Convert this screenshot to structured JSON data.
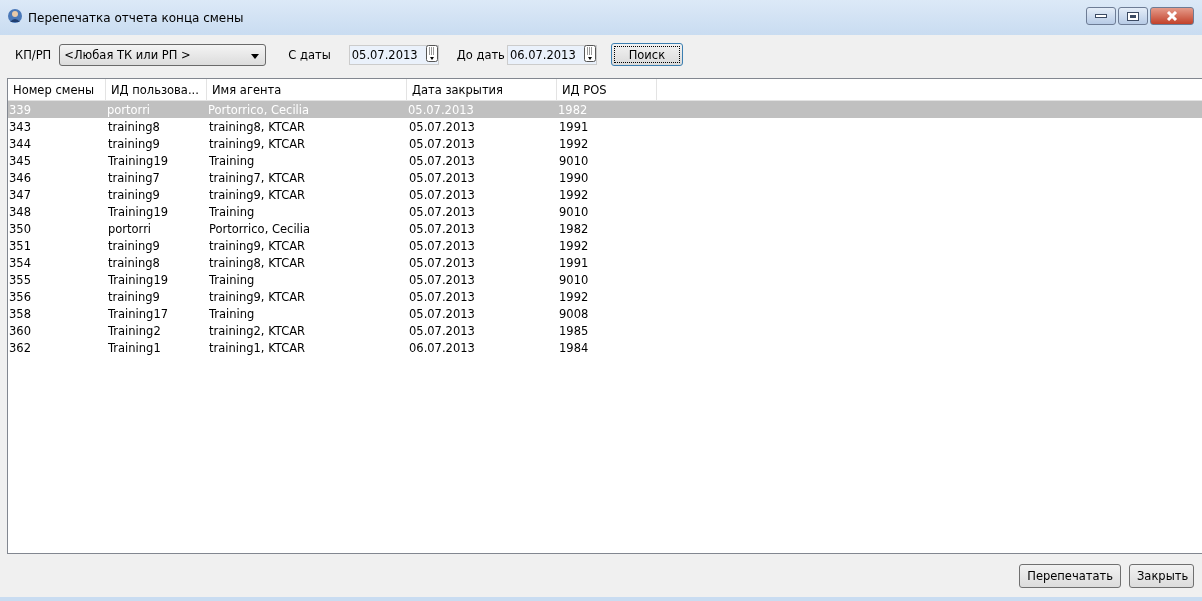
{
  "window": {
    "title": "Перепечатка отчета конца смены"
  },
  "filters": {
    "station_label": "КП/РП",
    "station_value": "<Любая ТК или РП >",
    "from_label": "С даты",
    "from_value": "05.07.2013",
    "to_label": "До дать",
    "to_value": "06.07.2013",
    "search_button": "Поиск"
  },
  "table": {
    "columns": [
      "Номер смены",
      "ИД пользова...",
      "Имя агента",
      "Дата закрытия",
      "ИД POS"
    ],
    "rows": [
      {
        "cells": [
          "339",
          "portorri",
          "Portorrico, Cecilia",
          "05.07.2013",
          "1982"
        ],
        "selected": true
      },
      {
        "cells": [
          "343",
          "training8",
          "training8, KTCAR",
          "05.07.2013",
          "1991"
        ],
        "selected": false
      },
      {
        "cells": [
          "344",
          "training9",
          "training9, KTCAR",
          "05.07.2013",
          "1992"
        ],
        "selected": false
      },
      {
        "cells": [
          "345",
          "Training19",
          "Training",
          "05.07.2013",
          "9010"
        ],
        "selected": false
      },
      {
        "cells": [
          "346",
          "training7",
          "training7, KTCAR",
          "05.07.2013",
          "1990"
        ],
        "selected": false
      },
      {
        "cells": [
          "347",
          "training9",
          "training9, KTCAR",
          "05.07.2013",
          "1992"
        ],
        "selected": false
      },
      {
        "cells": [
          "348",
          "Training19",
          "Training",
          "05.07.2013",
          "9010"
        ],
        "selected": false
      },
      {
        "cells": [
          "350",
          "portorri",
          "Portorrico, Cecilia",
          "05.07.2013",
          "1982"
        ],
        "selected": false
      },
      {
        "cells": [
          "351",
          "training9",
          "training9, KTCAR",
          "05.07.2013",
          "1992"
        ],
        "selected": false
      },
      {
        "cells": [
          "354",
          "training8",
          "training8, KTCAR",
          "05.07.2013",
          "1991"
        ],
        "selected": false
      },
      {
        "cells": [
          "355",
          "Training19",
          "Training",
          "05.07.2013",
          "9010"
        ],
        "selected": false
      },
      {
        "cells": [
          "356",
          "training9",
          "training9, KTCAR",
          "05.07.2013",
          "1992"
        ],
        "selected": false
      },
      {
        "cells": [
          "358",
          "Training17",
          "Training",
          "05.07.2013",
          "9008"
        ],
        "selected": false
      },
      {
        "cells": [
          "360",
          "Training2",
          "training2, KTCAR",
          "05.07.2013",
          "1985"
        ],
        "selected": false
      },
      {
        "cells": [
          "362",
          "Training1",
          "training1, KTCAR",
          "06.07.2013",
          "1984"
        ],
        "selected": false
      }
    ]
  },
  "buttons": [
    "Перепечатать",
    "Закрыть"
  ]
}
